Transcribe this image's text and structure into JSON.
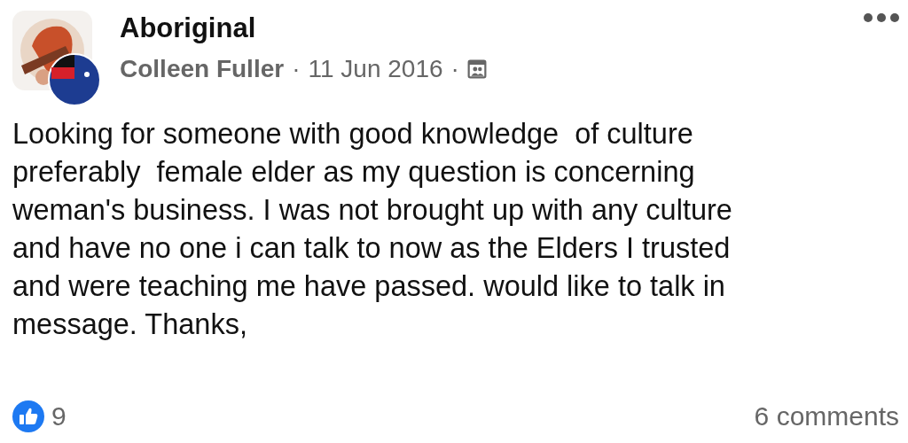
{
  "group": {
    "name": "Aboriginal"
  },
  "meta": {
    "author": "Colleen Fuller",
    "separator_1": "·",
    "date": "11 Jun 2016",
    "separator_2": "·"
  },
  "post": {
    "text": "Looking for someone with good knowledge  of culture\npreferably  female elder as my question is concerning\nweman's business. I was not brought up with any culture\nand have no one i can talk to now as the Elders I trusted\nand were teaching me have passed. would like to talk in\nmessage. Thanks,"
  },
  "footer": {
    "likes": "9",
    "comments": "6 comments"
  }
}
